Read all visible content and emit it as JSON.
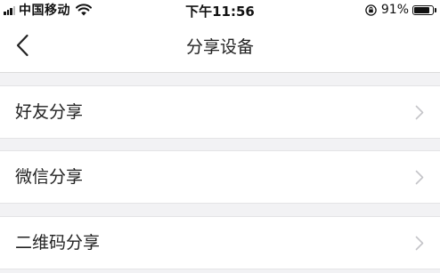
{
  "status_bar": {
    "carrier": "中国移动",
    "time": "下午11:56",
    "battery_percent": "91%",
    "battery_level": 0.91,
    "signal_icon": "signal-bars-icon",
    "wifi_icon": "wifi-icon",
    "orientation_lock_icon": "rotation-lock-icon"
  },
  "nav": {
    "title": "分享设备",
    "back_icon": "chevron-left-icon"
  },
  "share_options": [
    {
      "label": "好友分享",
      "icon": "chevron-right-icon"
    },
    {
      "label": "微信分享",
      "icon": "chevron-right-icon"
    },
    {
      "label": "二维码分享",
      "icon": "chevron-right-icon"
    }
  ],
  "colors": {
    "background": "#f2f2f4",
    "surface": "#ffffff",
    "text": "#222222",
    "chevron": "#c4c4c8"
  }
}
